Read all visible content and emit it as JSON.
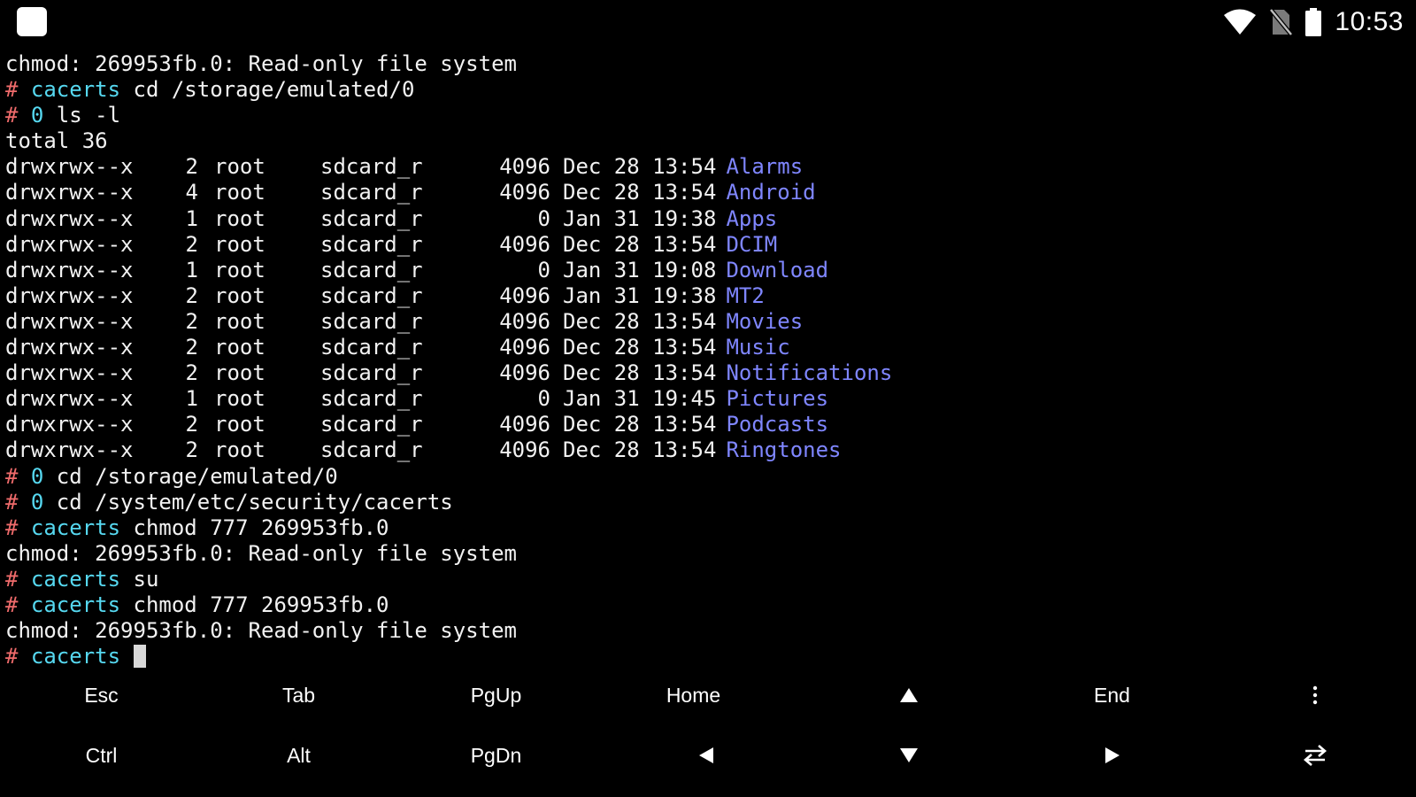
{
  "status_bar": {
    "time": "10:53",
    "icons": [
      "app-icon",
      "wifi-icon",
      "no-sim-icon",
      "battery-icon"
    ]
  },
  "colors": {
    "prompt_hash": "#ef6b6b",
    "prompt_cwd": "#56d8f0",
    "directory": "#7f86ff",
    "text": "#f2f2f2",
    "background": "#000000"
  },
  "terminal": {
    "line_top": "chmod: 269953fb.0: Read-only file system",
    "cmd1": {
      "hash": "#",
      "cwd": "cacerts",
      "cmd": " cd /storage/emulated/0"
    },
    "cmd2": {
      "hash": "#",
      "cwd": "0",
      "cmd": " ls -l"
    },
    "total": "total 36",
    "listing": [
      {
        "perm": "drwxrwx--x",
        "links": "2",
        "owner": "root",
        "group": "sdcard_r",
        "size": "4096",
        "date": "Dec 28 13:54",
        "name": "Alarms"
      },
      {
        "perm": "drwxrwx--x",
        "links": "4",
        "owner": "root",
        "group": "sdcard_r",
        "size": "4096",
        "date": "Dec 28 13:54",
        "name": "Android"
      },
      {
        "perm": "drwxrwx--x",
        "links": "1",
        "owner": "root",
        "group": "sdcard_r",
        "size": "0",
        "date": "Jan 31 19:38",
        "name": "Apps"
      },
      {
        "perm": "drwxrwx--x",
        "links": "2",
        "owner": "root",
        "group": "sdcard_r",
        "size": "4096",
        "date": "Dec 28 13:54",
        "name": "DCIM"
      },
      {
        "perm": "drwxrwx--x",
        "links": "1",
        "owner": "root",
        "group": "sdcard_r",
        "size": "0",
        "date": "Jan 31 19:08",
        "name": "Download"
      },
      {
        "perm": "drwxrwx--x",
        "links": "2",
        "owner": "root",
        "group": "sdcard_r",
        "size": "4096",
        "date": "Jan 31 19:38",
        "name": "MT2"
      },
      {
        "perm": "drwxrwx--x",
        "links": "2",
        "owner": "root",
        "group": "sdcard_r",
        "size": "4096",
        "date": "Dec 28 13:54",
        "name": "Movies"
      },
      {
        "perm": "drwxrwx--x",
        "links": "2",
        "owner": "root",
        "group": "sdcard_r",
        "size": "4096",
        "date": "Dec 28 13:54",
        "name": "Music"
      },
      {
        "perm": "drwxrwx--x",
        "links": "2",
        "owner": "root",
        "group": "sdcard_r",
        "size": "4096",
        "date": "Dec 28 13:54",
        "name": "Notifications"
      },
      {
        "perm": "drwxrwx--x",
        "links": "1",
        "owner": "root",
        "group": "sdcard_r",
        "size": "0",
        "date": "Jan 31 19:45",
        "name": "Pictures"
      },
      {
        "perm": "drwxrwx--x",
        "links": "2",
        "owner": "root",
        "group": "sdcard_r",
        "size": "4096",
        "date": "Dec 28 13:54",
        "name": "Podcasts"
      },
      {
        "perm": "drwxrwx--x",
        "links": "2",
        "owner": "root",
        "group": "sdcard_r",
        "size": "4096",
        "date": "Dec 28 13:54",
        "name": "Ringtones"
      }
    ],
    "cmd3": {
      "hash": "#",
      "cwd": "0",
      "cmd": " cd /storage/emulated/0"
    },
    "cmd4": {
      "hash": "#",
      "cwd": "0",
      "cmd": " cd /system/etc/security/cacerts"
    },
    "cmd5": {
      "hash": "#",
      "cwd": "cacerts",
      "cmd": " chmod 777 269953fb.0"
    },
    "err1": "chmod: 269953fb.0: Read-only file system",
    "cmd6": {
      "hash": "#",
      "cwd": "cacerts",
      "cmd": " su"
    },
    "cmd7": {
      "hash": "#",
      "cwd": "cacerts",
      "cmd": " chmod 777 269953fb.0"
    },
    "err2": "chmod: 269953fb.0: Read-only file system",
    "prompt": {
      "hash": "#",
      "cwd": "cacerts",
      "cmd": " "
    }
  },
  "extra_keys": {
    "row1": [
      "Esc",
      "Tab",
      "PgUp",
      "Home",
      "up-arrow-icon",
      "End",
      "more-vert-icon"
    ],
    "row2": [
      "Ctrl",
      "Alt",
      "PgDn",
      "left-arrow-icon",
      "down-arrow-icon",
      "right-arrow-icon",
      "swap-icon"
    ],
    "esc": "Esc",
    "tab": "Tab",
    "pgup": "PgUp",
    "home": "Home",
    "end": "End",
    "ctrl": "Ctrl",
    "alt": "Alt",
    "pgdn": "PgDn"
  }
}
